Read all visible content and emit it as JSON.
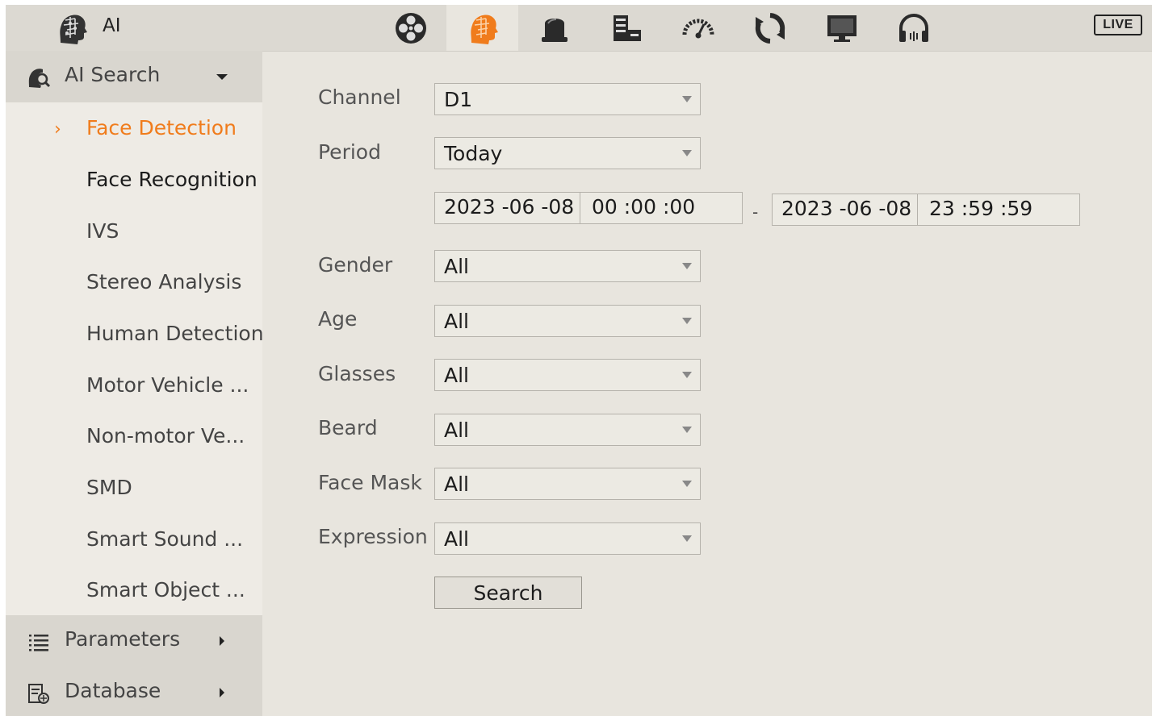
{
  "header": {
    "title": "AI",
    "live_label": "LIVE",
    "icons": [
      "film-reel-icon",
      "ai-head-icon",
      "storage-dome-icon",
      "network-device-icon",
      "speedometer-icon",
      "refresh-icon",
      "monitor-icon",
      "headset-icon"
    ],
    "active_icon": "ai-head-icon"
  },
  "sidebar": {
    "ai_search": {
      "label": "AI Search",
      "icon": "ai-search-icon"
    },
    "items": [
      {
        "label": "Face Detection"
      },
      {
        "label": "Face Recognition"
      },
      {
        "label": "IVS"
      },
      {
        "label": "Stereo Analysis"
      },
      {
        "label": "Human Detection"
      },
      {
        "label": "Motor Vehicle ..."
      },
      {
        "label": "Non-motor Ve..."
      },
      {
        "label": "SMD"
      },
      {
        "label": "Smart Sound ..."
      },
      {
        "label": "Smart Object ..."
      }
    ],
    "selected": "Face Detection",
    "parameters": {
      "label": "Parameters",
      "icon": "list-icon"
    },
    "database": {
      "label": "Database",
      "icon": "database-icon"
    }
  },
  "form": {
    "channel": {
      "label": "Channel",
      "value": "D1"
    },
    "period": {
      "label": "Period",
      "value": "Today"
    },
    "start": {
      "date": "2023 -06 -08",
      "time": "00 :00 :00"
    },
    "range_separator": "-",
    "end": {
      "date": "2023 -06 -08",
      "time": "23 :59 :59"
    },
    "gender": {
      "label": "Gender",
      "value": "All"
    },
    "age": {
      "label": "Age",
      "value": "All"
    },
    "glasses": {
      "label": "Glasses",
      "value": "All"
    },
    "beard": {
      "label": "Beard",
      "value": "All"
    },
    "face_mask": {
      "label": "Face Mask",
      "value": "All"
    },
    "expression": {
      "label": "Expression",
      "value": "All"
    },
    "search_label": "Search"
  },
  "colors": {
    "accent": "#f07c1c",
    "background": "#e8e5de",
    "topbar": "#dcd9d2",
    "sidebar_header": "#d9d6cf"
  }
}
